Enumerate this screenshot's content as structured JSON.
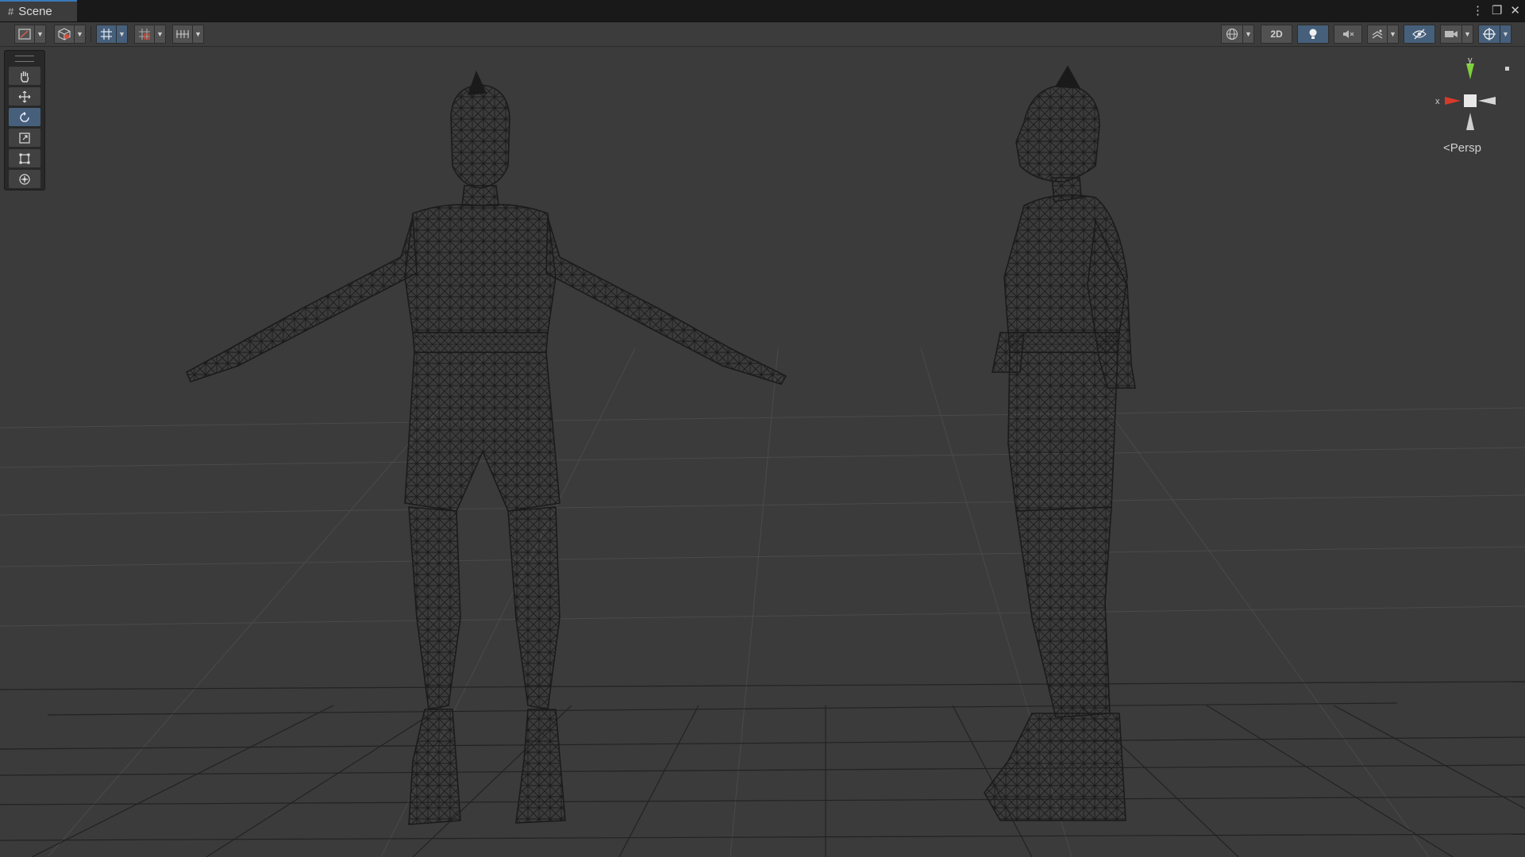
{
  "window": {
    "tab_title": "Scene",
    "tab_icon": "grid-hash-icon"
  },
  "toolbar": {
    "left_buttons": [
      "draw-mode-icon",
      "gizmo-cube-icon",
      "grid-snap-icon",
      "snap-increment-icon",
      "grid-visibility-icon"
    ],
    "right_buttons": [
      "render-mode-sphere-icon",
      "lighting-icon",
      "audio-mute-icon",
      "effects-icon",
      "scene-visibility-icon",
      "camera-icon",
      "gizmos-icon"
    ],
    "two_d_label": "2D"
  },
  "tools_panel": {
    "tools": [
      "hand-tool-icon",
      "move-tool-icon",
      "rotate-tool-icon",
      "scale-tool-icon",
      "rect-tool-icon",
      "transform-tool-icon"
    ],
    "active_tool": "rotate-tool-icon"
  },
  "orientation_gizmo": {
    "y_label": "y",
    "x_label": "x",
    "projection_label": "Persp",
    "colors": {
      "y": "#7fd13b",
      "x": "#d83a2a",
      "z": "#d6d6d6"
    }
  },
  "scene": {
    "background": "#3b3b3b",
    "wire_color": "#1a1a1a"
  }
}
